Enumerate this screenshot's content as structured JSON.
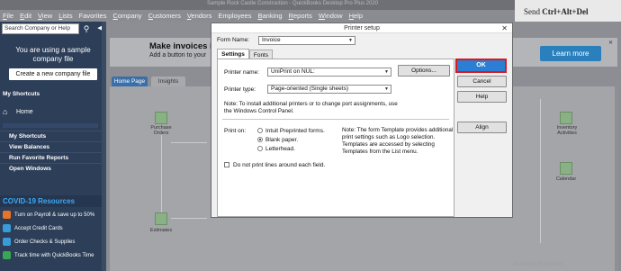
{
  "window": {
    "title": "Sample Rock Castle Construction - QuickBooks Desktop Pro Plus 2020",
    "send_hint_prefix": "Send",
    "send_hint_keys": "Ctrl+Alt+Del"
  },
  "menu": [
    "File",
    "Edit",
    "View",
    "Lists",
    "Favorites",
    "Company",
    "Customers",
    "Vendors",
    "Employees",
    "Banking",
    "Reports",
    "Window",
    "Help"
  ],
  "leftnav": {
    "search_placeholder": "Search Company or Help",
    "search_icon": "magnifier",
    "sample_text": "You are using a sample company file",
    "create_button": "Create a new company file",
    "my_shortcuts_header": "My Shortcuts",
    "home_label": "Home",
    "list_items": [
      "My Shortcuts",
      "View Balances",
      "Run Favorite Reports",
      "Open Windows"
    ],
    "covid_header": "COVID-19 Resources",
    "covid_items": [
      {
        "label": "Turn on Payroll & save up to 50%",
        "color": "#e8742a"
      },
      {
        "label": "Accept Credit Cards",
        "color": "#3a9bd9"
      },
      {
        "label": "Order Checks & Supplies",
        "color": "#3a9bd9"
      },
      {
        "label": "Track time with QuickBooks Time",
        "color": "#3aa655"
      }
    ]
  },
  "main": {
    "banner_title": "Make invoices in",
    "banner_sub": "Add a button to your",
    "learn_more": "Learn more",
    "tabs": [
      "Home Page",
      "Insights"
    ],
    "flow_labels": [
      "Purchase Orders",
      "Estimates",
      "Inventory Activities",
      "Calendar"
    ],
    "watermark": "Activate Windows"
  },
  "dialog": {
    "title": "Printer setup",
    "form_name_label": "Form Name:",
    "form_name_value": "Invoice",
    "tabs": [
      "Settings",
      "Fonts"
    ],
    "printer_name_label": "Printer name:",
    "printer_name_value": "UniPrint on NUL:",
    "options_button": "Options...",
    "printer_type_label": "Printer type:",
    "printer_type_value": "Page-oriented (Single sheets)",
    "install_note": "Note: To install additional printers or to change port assignments, use the Windows Control Panel.",
    "print_on_label": "Print on:",
    "print_on_options": [
      "Intuit Preprinted forms.",
      "Blank paper.",
      "Letterhead."
    ],
    "print_on_selected": "Blank paper.",
    "template_note": "Note: The form Template provides additional print settings such as Logo selection.  Templates are accessed by selecting Templates from the List menu.",
    "no_lines_label": "Do not print lines around each field.",
    "buttons": {
      "ok": "OK",
      "cancel": "Cancel",
      "help": "Help",
      "align": "Align"
    },
    "ok_highlight_color": "#d8191e"
  }
}
